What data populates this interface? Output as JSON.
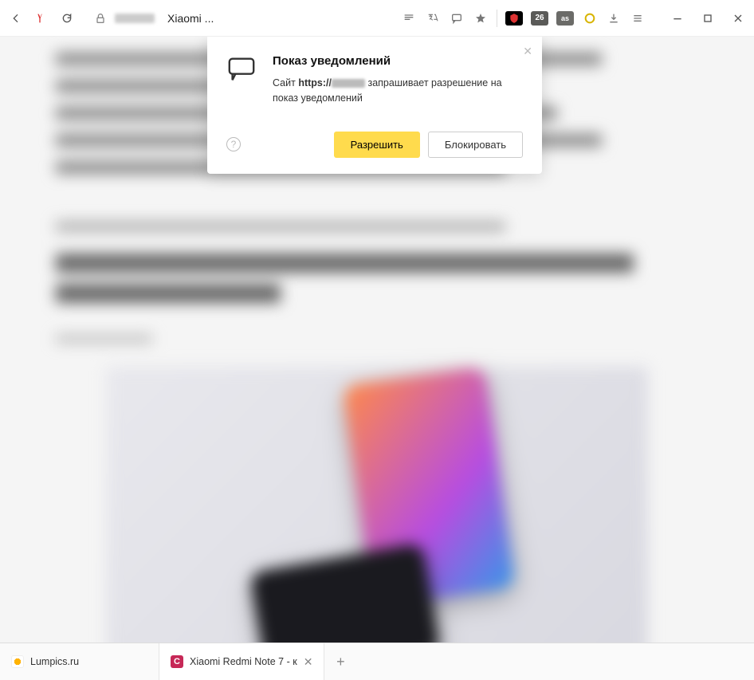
{
  "toolbar": {
    "tab_title": "Xiaomi ...",
    "ext_badge_number": "26"
  },
  "popup": {
    "title": "Показ уведомлений",
    "msg_prefix": "Сайт ",
    "msg_protocol": "https://",
    "msg_suffix": " запрашивает разрешение на показ уведомлений",
    "help": "?",
    "allow": "Разрешить",
    "block": "Блокировать"
  },
  "tabs": {
    "items": [
      {
        "label": "Lumpics.ru",
        "fav_color": "#ffb300"
      },
      {
        "label": "Xiaomi Redmi Note 7 - к",
        "fav_color": "#c62857"
      }
    ]
  }
}
